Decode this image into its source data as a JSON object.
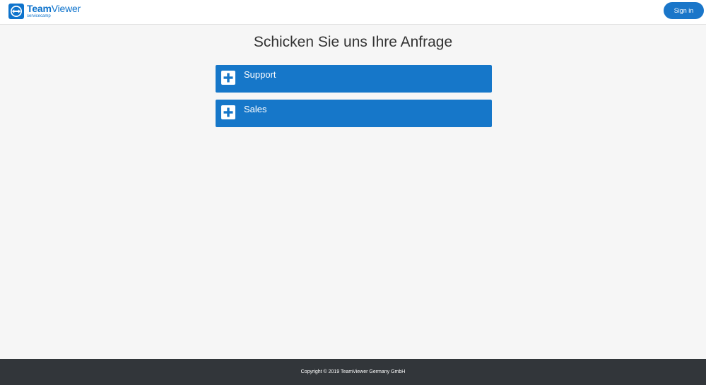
{
  "header": {
    "logo": {
      "brand_bold": "Team",
      "brand_regular": "Viewer",
      "subtitle": "servicecamp",
      "icon": "teamviewer-logo-icon"
    },
    "signin_label": "Sign in"
  },
  "main": {
    "title": "Schicken Sie uns Ihre Anfrage",
    "panels": [
      {
        "label": "Support",
        "icon": "plus-icon"
      },
      {
        "label": "Sales",
        "icon": "plus-icon"
      }
    ]
  },
  "footer": {
    "copyright": "Copyright © 2019 TeamViewer Germany GmbH"
  },
  "colors": {
    "brand_blue": "#0e73cc",
    "panel_blue": "#1677c9",
    "page_bg": "#f6f6f6",
    "footer_bg": "#32363a"
  }
}
